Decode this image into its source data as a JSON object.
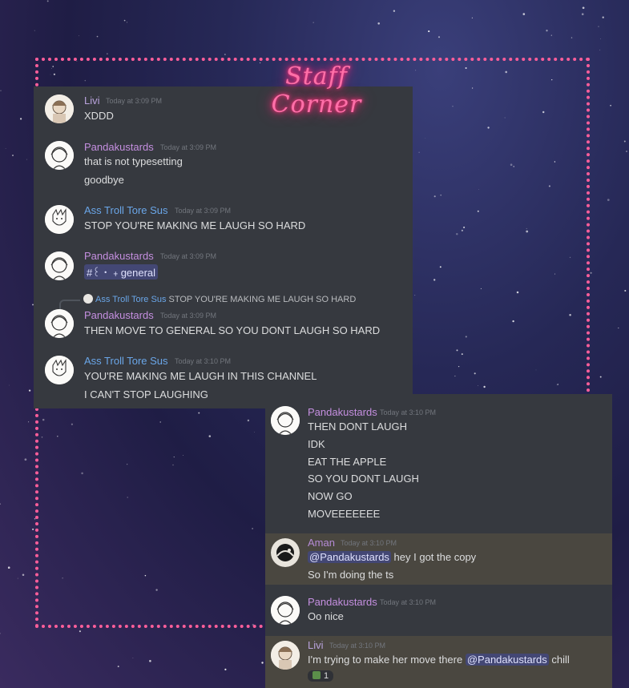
{
  "title": "Staff Corner",
  "colors": {
    "border": "#ff5e9a",
    "panel": "#36393f",
    "mention_bg": "#434774"
  },
  "messages_top": [
    {
      "author": "Livi",
      "time": "Today at 3:09 PM",
      "lines": [
        "XDDD"
      ]
    },
    {
      "author": "Pandakustards",
      "time": "Today at 3:09 PM",
      "lines": [
        "that is not typesetting",
        "goodbye"
      ]
    },
    {
      "author": "Ass Troll Tore Sus",
      "time": "Today at 3:09 PM",
      "lines": [
        "STOP YOU'RE MAKING ME LAUGH SO HARD"
      ]
    },
    {
      "author": "Pandakustards",
      "time": "Today at 3:09 PM",
      "channel": "#꒰ ･ ﹢general"
    },
    {
      "reply_author": "Ass Troll Tore Sus",
      "reply_text": "STOP YOU'RE MAKING ME LAUGH SO HARD",
      "author": "Pandakustards",
      "time": "Today at 3:09 PM",
      "lines": [
        "THEN MOVE TO GENERAL SO YOU DONT LAUGH SO HARD"
      ]
    },
    {
      "author": "Ass Troll Tore Sus",
      "time": "Today at 3:10 PM",
      "lines": [
        "YOU'RE MAKING ME LAUGH IN THIS CHANNEL",
        "I CAN'T STOP LAUGHING"
      ]
    }
  ],
  "messages_bottom": [
    {
      "author": "Pandakustards",
      "time": "Today at 3:10 PM",
      "lines": [
        "THEN DONT LAUGH",
        "IDK",
        "EAT THE APPLE",
        "SO YOU DONT LAUGH",
        "NOW GO",
        "MOVEEEEEEE"
      ]
    },
    {
      "author": "Aman",
      "time": "Today at 3:10 PM",
      "mention": "@Pandakustards",
      "after_mention": "hey I got the copy",
      "lines": [
        "So I'm doing the ts"
      ]
    },
    {
      "author": "Pandakustards",
      "time": "Today at 3:10 PM",
      "lines": [
        "Oo nice"
      ]
    },
    {
      "author": "Livi",
      "time": "Today at 3:10 PM",
      "before_mention": "I'm trying to make her move there",
      "mention": "@Pandakustards",
      "after_mention": "chill",
      "reaction_count": "1",
      "reaction_icon": "plant-emoji"
    }
  ]
}
